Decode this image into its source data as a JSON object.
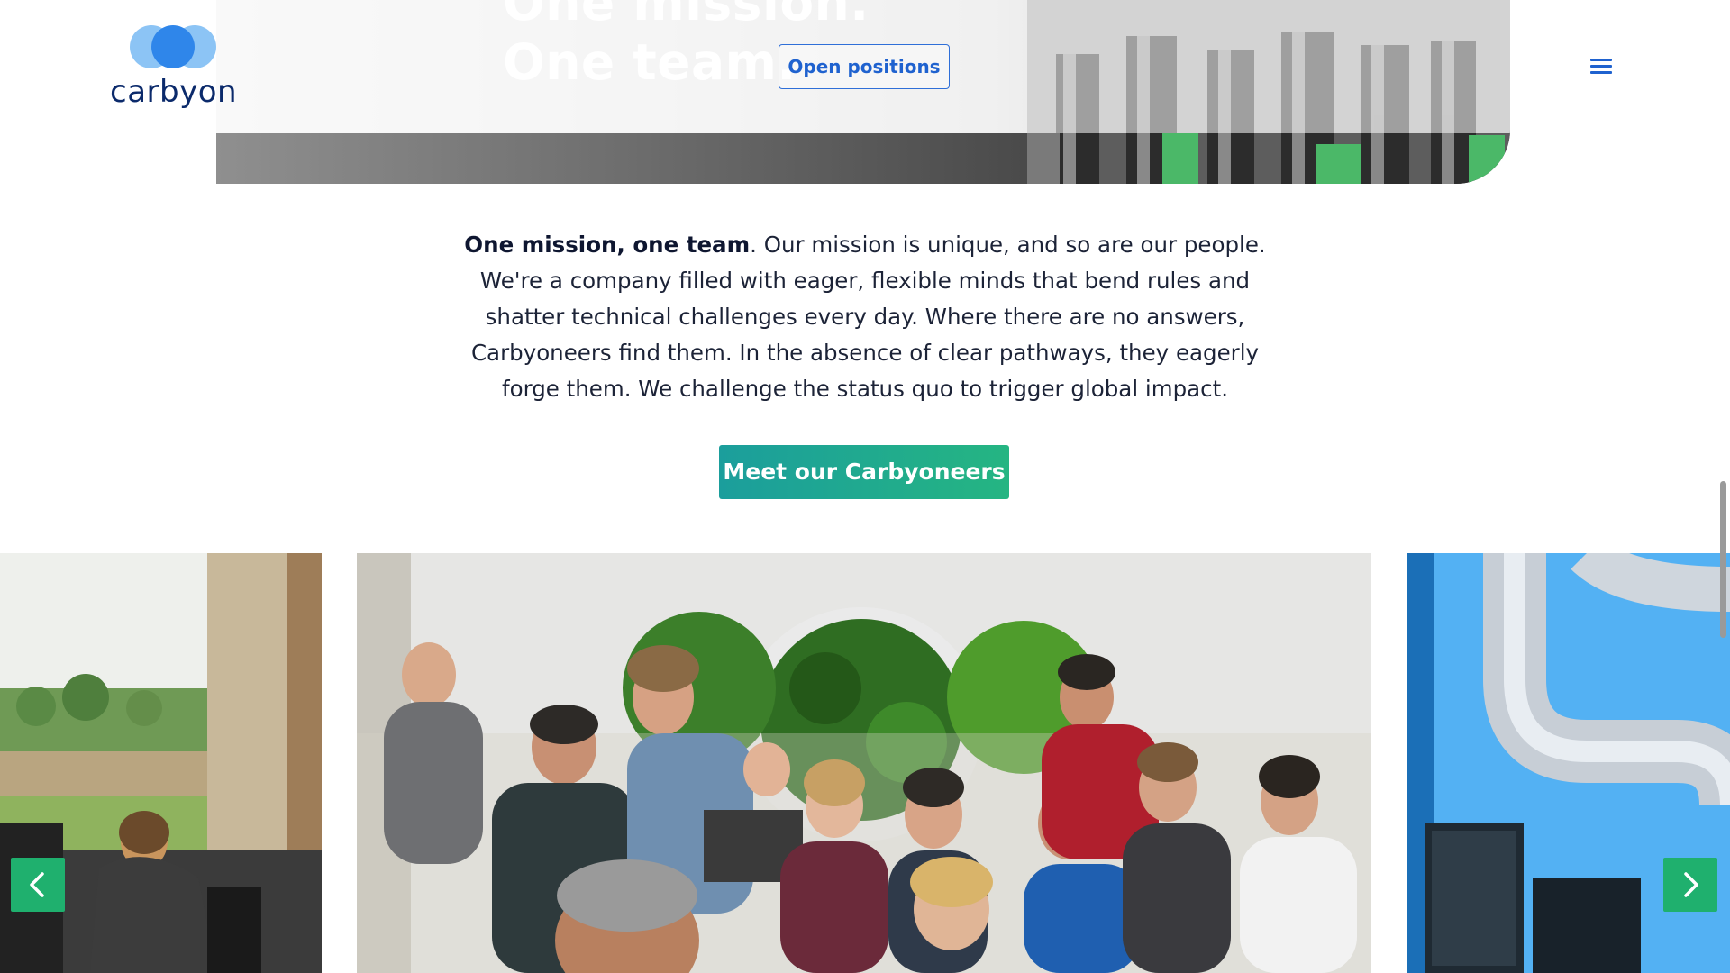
{
  "header": {
    "logo_text": "carbyon",
    "open_positions_label": "Open positions",
    "menu_icon": "hamburger-menu-icon"
  },
  "hero": {
    "title_line_1": "One mission.",
    "title_line_2": "One team."
  },
  "intro": {
    "lead_bold": "One mission, one team",
    "body": ". Our mission is unique, and so are our people. We're a company filled with eager, flexible minds that bend rules and shatter technical challenges every day. Where there are no answers, Carbyoneers find them. In the absence of clear pathways, they eagerly forge them. We challenge the status quo to trigger global impact."
  },
  "cta": {
    "label": "Meet our Carbyoneers"
  },
  "carousel": {
    "prev_icon": "chevron-left-icon",
    "next_icon": "chevron-right-icon",
    "slides": [
      {
        "name": "office-window-photo"
      },
      {
        "name": "team-meeting-photo"
      },
      {
        "name": "pipe-installation-photo"
      }
    ]
  },
  "colors": {
    "brand_navy": "#0b2a6b",
    "brand_blue": "#2f6fd8",
    "cta_gradient_start": "#1b9e9c",
    "cta_gradient_end": "#25b582",
    "arrow_green": "#1fb06e"
  }
}
